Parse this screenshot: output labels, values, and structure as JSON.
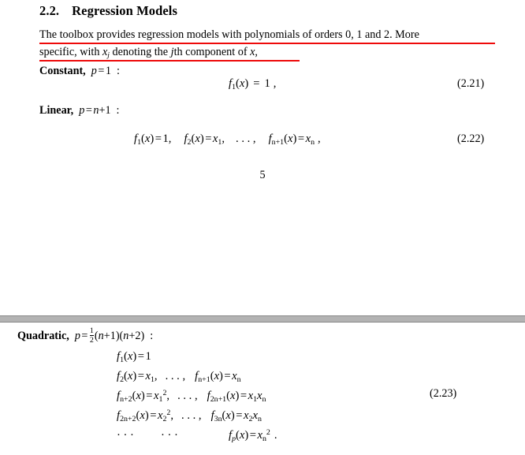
{
  "document": {
    "page_number": "5",
    "accent_underline_color": "#ee0a0a",
    "separator_color": "#b3b3b3"
  },
  "section": {
    "number": "2.2.",
    "title": "Regression Models"
  },
  "paragraph": {
    "line1": "The toolbox provides regression models with polynomials of orders 0, 1 and 2.  More",
    "line2_a": "specific, with ",
    "line2_x": "x",
    "line2_xsub": "j",
    "line2_b": " denoting the ",
    "line2_j": "j",
    "line2_c": "th component of ",
    "line2_xend": "x",
    "line2_d": ","
  },
  "models": {
    "constant": {
      "label": "Constant,",
      "param_p": "p",
      "param_eq": "=",
      "param_value": "1",
      "colon": ":"
    },
    "linear": {
      "label": "Linear,",
      "param_p": "p",
      "param_eq": "=",
      "param_n": "n",
      "param_plus1": "+1",
      "colon": ":"
    },
    "quadratic": {
      "label": "Quadratic,",
      "param_p": "p",
      "param_eq": "=",
      "frac_num": "1",
      "frac_den": "2",
      "param_rest_a": "(",
      "param_n1": "n",
      "param_rest_b": "+1)(",
      "param_n2": "n",
      "param_rest_c": "+2)",
      "colon": ":"
    }
  },
  "equations": {
    "eq221": {
      "tag": "(2.21)",
      "f": "f",
      "f_sub": "1",
      "arg": "(",
      "arg_x": "x",
      "arg_close": ")",
      "eq": "=",
      "rhs": "1",
      "punct": ","
    },
    "eq222": {
      "tag": "(2.22)",
      "t1_f": "f",
      "t1_sub": "1",
      "t1_x": "x",
      "t1_rhs": "1",
      "t1_punct": ",",
      "t2_f": "f",
      "t2_sub": "2",
      "t2_x": "x",
      "t2_rhs_x": "x",
      "t2_rhs_sub": "1",
      "t2_punct": ",",
      "dots": ". . . ,",
      "t3_f": "f",
      "t3_sub": "n+1",
      "t3_x": "x",
      "t3_rhs_x": "x",
      "t3_rhs_sub": "n",
      "t3_punct": ","
    },
    "eq223": {
      "tag": "(2.23)",
      "row1": {
        "f": "f",
        "sub": "1",
        "x": "x",
        "eq": "=",
        "rhs": "1"
      },
      "row2": {
        "f1": "f",
        "sub1": "2",
        "x1": "x",
        "eq1": "=",
        "rhs1_x": "x",
        "rhs1_sub": "1",
        "comma1": ",",
        "dots": ". . . ,",
        "f2": "f",
        "sub2": "n+1",
        "x2": "x",
        "eq2": "=",
        "rhs2_x": "x",
        "rhs2_sub": "n"
      },
      "row3": {
        "f1": "f",
        "sub1": "n+2",
        "x1": "x",
        "eq1": "=",
        "rhs1_x": "x",
        "rhs1_sub": "1",
        "rhs1_sup": "2",
        "comma1": ",",
        "dots": ". . . ,",
        "f2": "f",
        "sub2": "2n+1",
        "x2": "x",
        "eq2": "=",
        "rhs2_x1": "x",
        "rhs2_sub1": "1",
        "rhs2_x2": "x",
        "rhs2_sub2": "n"
      },
      "row4": {
        "f1": "f",
        "sub1": "2n+2",
        "x1": "x",
        "eq1": "=",
        "rhs1_x": "x",
        "rhs1_sub": "2",
        "rhs1_sup": "2",
        "comma1": ",",
        "dots": ". . . ,",
        "f2": "f",
        "sub2": "3n",
        "x2": "x",
        "eq2": "=",
        "rhs2_x1": "x",
        "rhs2_sub1": "2",
        "rhs2_x2": "x",
        "rhs2_sub2": "n"
      },
      "row5": {
        "dots1": "· · ·",
        "dots2": "· · ·",
        "f": "f",
        "sub": "p",
        "x": "x",
        "eq": "=",
        "rhs_x": "x",
        "rhs_sub": "n",
        "rhs_sup": "2",
        "period": "."
      }
    }
  }
}
